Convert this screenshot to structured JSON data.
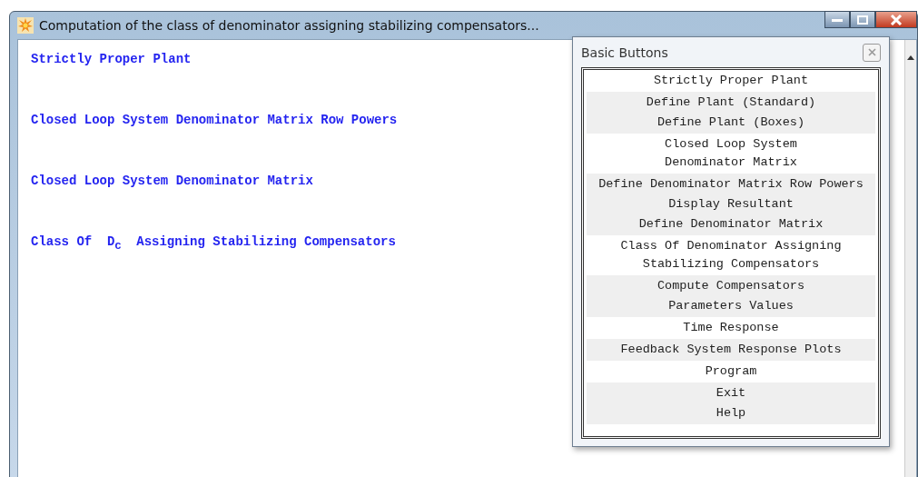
{
  "window": {
    "title": "Computation of the class of denominator assigning stabilizing compensators..."
  },
  "content": {
    "links": [
      "Strictly Proper Plant",
      "Closed Loop System Denominator Matrix Row Powers",
      "Closed Loop System Denominator Matrix",
      "Class Of  D$_{C}$  Assigning Stabilizing Compensators"
    ]
  },
  "palette": {
    "title": "Basic Buttons",
    "groups": [
      {
        "buttons": [
          "Strictly Proper Plant"
        ]
      },
      {
        "buttons": [
          "Define Plant (Standard)",
          "Define Plant (Boxes)"
        ]
      },
      {
        "buttons": [
          "Closed Loop System\nDenominator Matrix"
        ]
      },
      {
        "buttons": [
          "Define Denominator Matrix Row Powers",
          "Display Resultant",
          "Define Denominator Matrix"
        ]
      },
      {
        "buttons": [
          "Class Of Denominator Assigning\nStabilizing Compensators"
        ]
      },
      {
        "buttons": [
          "Compute Compensators",
          "Parameters Values"
        ]
      },
      {
        "buttons": [
          "Time Response"
        ]
      },
      {
        "buttons": [
          "Feedback System Response Plots"
        ]
      },
      {
        "buttons": [
          "Program"
        ]
      },
      {
        "buttons": [
          "Exit",
          "Help"
        ]
      }
    ]
  }
}
